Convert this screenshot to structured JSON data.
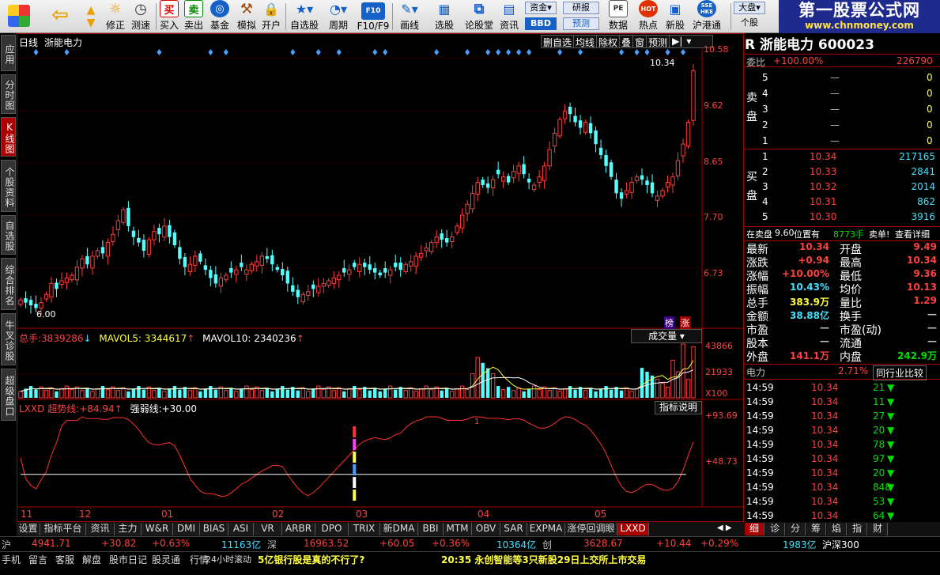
{
  "toolbar": {
    "items": [
      {
        "label": "修正",
        "icon": "sun-icon"
      },
      {
        "label": "测速",
        "icon": "clock-icon"
      },
      {
        "label": "买入",
        "icon": "buy-icon"
      },
      {
        "label": "卖出",
        "icon": "sell-icon"
      },
      {
        "label": "基金",
        "icon": "fund-icon"
      },
      {
        "label": "模拟",
        "icon": "hammer-icon"
      },
      {
        "label": "开户",
        "icon": "lock-icon"
      },
      {
        "label": "自选股",
        "icon": "star-icon"
      },
      {
        "label": "周期",
        "icon": "period-icon"
      },
      {
        "label": "F10/F9",
        "icon": "f10-icon"
      },
      {
        "label": "画线",
        "icon": "pen-icon"
      },
      {
        "label": "选股",
        "icon": "select-icon"
      },
      {
        "label": "论股堂",
        "icon": "forum-icon"
      },
      {
        "label": "资讯",
        "icon": "news-icon"
      },
      {
        "label": "数据",
        "icon": "pe-icon"
      },
      {
        "label": "热点",
        "icon": "hot-icon"
      },
      {
        "label": "新股",
        "icon": "newstock-icon"
      },
      {
        "label": "沪港通",
        "icon": "hk-icon"
      },
      {
        "label": "个股",
        "icon": "stock-icon"
      }
    ],
    "small_buttons": {
      "zijin": "资金",
      "bbd": "BBD",
      "yanbao": "研报",
      "yuce": "预测",
      "dapan": "大盘"
    },
    "glyphs": {
      "buy": "买",
      "sell": "卖",
      "hot": "HOT",
      "pe": "PE",
      "f10": "F10",
      "hk": "SSE HKE"
    }
  },
  "brand": {
    "title": "第一股票公式网",
    "url": "www.chnmoney.com"
  },
  "left_tabs": [
    "应用",
    "分时图",
    "K线图",
    "个股资料",
    "自选股",
    "综合排名",
    "牛叉诊股",
    "超级盘口"
  ],
  "chart": {
    "period": "日线",
    "stock": "浙能电力",
    "overlay_buttons": [
      "删自选",
      "均线",
      "除权",
      "叠",
      "窗",
      "预测"
    ],
    "price_axis": [
      "10.58",
      "9.62",
      "8.65",
      "7.70",
      "6.73"
    ],
    "high_label": "10.34",
    "low_label": "6.00",
    "badges": [
      "榜",
      "涨"
    ],
    "volume_legend": {
      "total_label": "总手:",
      "total": "3839286",
      "ma5_label": "MAVOL5:",
      "ma5": "3344617",
      "ma10_label": "MAVOL10:",
      "ma10": "2340236",
      "button": "成交量"
    },
    "volume_axis": [
      "43866",
      "21933",
      "X100"
    ],
    "indicator_legend": {
      "name": "LXXD",
      "trend_label": "超势线:",
      "trend": "+84.94",
      "strong_label": "强弱线:",
      "strong": "+30.00",
      "button": "指标说明"
    },
    "indicator_axis": [
      "+93.69",
      "+48.73"
    ],
    "indicator_marker": "1",
    "months": [
      "11",
      "12",
      "01",
      "02",
      "03",
      "04",
      "05"
    ]
  },
  "chart_data": {
    "type": "candlestick",
    "stock": "浙能电力",
    "price_axis_ticks": [
      10.58,
      9.62,
      8.65,
      7.7,
      6.73
    ],
    "high": 10.34,
    "low": 6.0,
    "closes": [
      6.15,
      6.1,
      6.05,
      6.0,
      6.1,
      6.25,
      6.45,
      6.35,
      6.5,
      6.55,
      6.6,
      6.75,
      6.9,
      6.8,
      6.95,
      7.05,
      7.0,
      7.2,
      7.35,
      7.6,
      7.8,
      7.5,
      7.3,
      7.2,
      7.05,
      7.25,
      7.4,
      7.35,
      7.5,
      7.3,
      7.15,
      6.9,
      6.75,
      6.8,
      6.95,
      6.85,
      6.7,
      6.55,
      6.45,
      6.55,
      6.6,
      6.65,
      6.7,
      6.75,
      6.7,
      6.8,
      6.85,
      6.95,
      6.9,
      6.8,
      6.7,
      6.6,
      6.45,
      6.3,
      6.2,
      6.25,
      6.3,
      6.35,
      6.4,
      6.45,
      6.5,
      6.55,
      6.6,
      6.65,
      6.7,
      6.75,
      6.8,
      6.75,
      6.7,
      6.65,
      6.6,
      6.65,
      6.7,
      6.75,
      6.7,
      6.8,
      6.85,
      6.95,
      7.0,
      7.1,
      7.2,
      7.3,
      7.25,
      7.2,
      7.3,
      7.5,
      7.7,
      7.9,
      8.1,
      8.3,
      8.25,
      8.2,
      8.35,
      8.45,
      8.4,
      8.3,
      8.5,
      8.6,
      8.45,
      8.3,
      8.25,
      8.4,
      8.6,
      8.9,
      9.2,
      9.45,
      9.6,
      9.55,
      9.4,
      9.3,
      9.4,
      9.2,
      9.0,
      8.8,
      8.6,
      8.4,
      8.1,
      8.0,
      8.15,
      8.3,
      8.4,
      8.35,
      8.25,
      8.1,
      8.05,
      8.15,
      8.3,
      8.4,
      8.7,
      9.0,
      9.4,
      10.34
    ],
    "volume": {
      "total": 3839286,
      "mavol5": 3344617,
      "mavol10": 2340236,
      "axis_ticks": [
        43866,
        21933
      ],
      "unit": "X100"
    },
    "indicator": {
      "name": "LXXD",
      "trend": 84.94,
      "strong": 30.0,
      "axis_ticks": [
        93.69,
        48.73
      ]
    }
  },
  "quote": {
    "code_title": "R 浙能电力 600023",
    "weibi": {
      "label": "委比",
      "pct": "+100.00%",
      "diff": "226790"
    },
    "sell_label": [
      "卖",
      "盘"
    ],
    "buy_label": [
      "买",
      "盘"
    ],
    "sell": [
      {
        "lvl": "5",
        "price": "—",
        "vol": "0"
      },
      {
        "lvl": "4",
        "price": "—",
        "vol": "0"
      },
      {
        "lvl": "3",
        "price": "—",
        "vol": "0"
      },
      {
        "lvl": "2",
        "price": "—",
        "vol": "0"
      },
      {
        "lvl": "1",
        "price": "—",
        "vol": "0"
      }
    ],
    "buy": [
      {
        "lvl": "1",
        "price": "10.34",
        "vol": "217165"
      },
      {
        "lvl": "2",
        "price": "10.33",
        "vol": "2841"
      },
      {
        "lvl": "3",
        "price": "10.32",
        "vol": "2014"
      },
      {
        "lvl": "4",
        "price": "10.31",
        "vol": "862"
      },
      {
        "lvl": "5",
        "price": "10.30",
        "vol": "3916"
      }
    ],
    "notice": {
      "prefix": "在卖盘",
      "price": "9.60",
      "pos": "位置有",
      "vol": "8773手",
      "action": "卖单!",
      "link": "查看详细"
    },
    "stats": [
      {
        "l1": "最新",
        "v1": "10.34",
        "c1": "red",
        "l2": "开盘",
        "v2": "9.49",
        "c2": "red"
      },
      {
        "l1": "涨跌",
        "v1": "+0.94",
        "c1": "red",
        "l2": "最高",
        "v2": "10.34",
        "c2": "red"
      },
      {
        "l1": "涨幅",
        "v1": "+10.00%",
        "c1": "red",
        "l2": "最低",
        "v2": "9.36",
        "c2": "red"
      },
      {
        "l1": "振幅",
        "v1": "10.43%",
        "c1": "cyan",
        "l2": "均价",
        "v2": "10.13",
        "c2": "red"
      },
      {
        "l1": "总手",
        "v1": "383.9万",
        "c1": "yellow",
        "l2": "量比",
        "v2": "1.29",
        "c2": "red"
      },
      {
        "l1": "金额",
        "v1": "38.88亿",
        "c1": "cyan",
        "l2": "换手",
        "v2": "—",
        "c2": "gray"
      },
      {
        "l1": "市盈",
        "v1": "—",
        "c1": "gray",
        "l2": "市盈(动)",
        "v2": "—",
        "c2": "gray"
      },
      {
        "l1": "股本",
        "v1": "—",
        "c1": "gray",
        "l2": "流通",
        "v2": "—",
        "c2": "gray"
      },
      {
        "l1": "外盘",
        "v1": "141.1万",
        "c1": "red",
        "l2": "内盘",
        "v2": "242.9万",
        "c2": "green"
      }
    ],
    "industry": {
      "name": "电力",
      "pct": "2.71%",
      "button": "同行业比较"
    },
    "ticks": [
      {
        "t": "14:59",
        "p": "10.34",
        "v": "21"
      },
      {
        "t": "14:59",
        "p": "10.34",
        "v": "11"
      },
      {
        "t": "14:59",
        "p": "10.34",
        "v": "27"
      },
      {
        "t": "14:59",
        "p": "10.34",
        "v": "20"
      },
      {
        "t": "14:59",
        "p": "10.34",
        "v": "78"
      },
      {
        "t": "14:59",
        "p": "10.34",
        "v": "97"
      },
      {
        "t": "14:59",
        "p": "10.34",
        "v": "20"
      },
      {
        "t": "14:59",
        "p": "10.34",
        "v": "848"
      },
      {
        "t": "14:59",
        "p": "10.34",
        "v": "53"
      },
      {
        "t": "14:59",
        "p": "10.34",
        "v": "64"
      }
    ]
  },
  "bottom_tabs": [
    "设置",
    "指标平台",
    "资讯",
    "主力",
    "W&R",
    "DMI",
    "BIAS",
    "ASI",
    "VR",
    "ARBR",
    "DPO",
    "TRIX",
    "新DMA",
    "BBI",
    "MTM",
    "OBV",
    "SAR",
    "EXPMA",
    "涨停回调眼",
    "LXXD"
  ],
  "right_tabs": [
    "细",
    "诊",
    "分",
    "筹",
    "焰",
    "指",
    "财"
  ],
  "index_bar": {
    "sh_label": "沪",
    "sh_val": "4941.71",
    "sh_chg": "+30.82",
    "sh_pct": "+0.63%",
    "sh_amt": "11163亿",
    "sz_label": "深",
    "sz_val": "16963.52",
    "sz_chg": "+60.05",
    "sz_pct": "+0.36%",
    "sz_amt": "10364亿",
    "cy_label": "创",
    "cy_val": "3628.67",
    "cy_chg": "+10.44",
    "cy_pct": "+0.29%",
    "cy_amt": "1983亿",
    "hs_label": "沪深300"
  },
  "status": {
    "items": [
      "手机",
      "留言",
      "客服",
      "解盘",
      "股市日记",
      "股灵通",
      "行情"
    ],
    "scroll_label": "24小时滚动",
    "headline1": "5亿银行股是真的不行了?",
    "headline2": "20:35 永创智能等3只新股29日上交所上市交易"
  }
}
